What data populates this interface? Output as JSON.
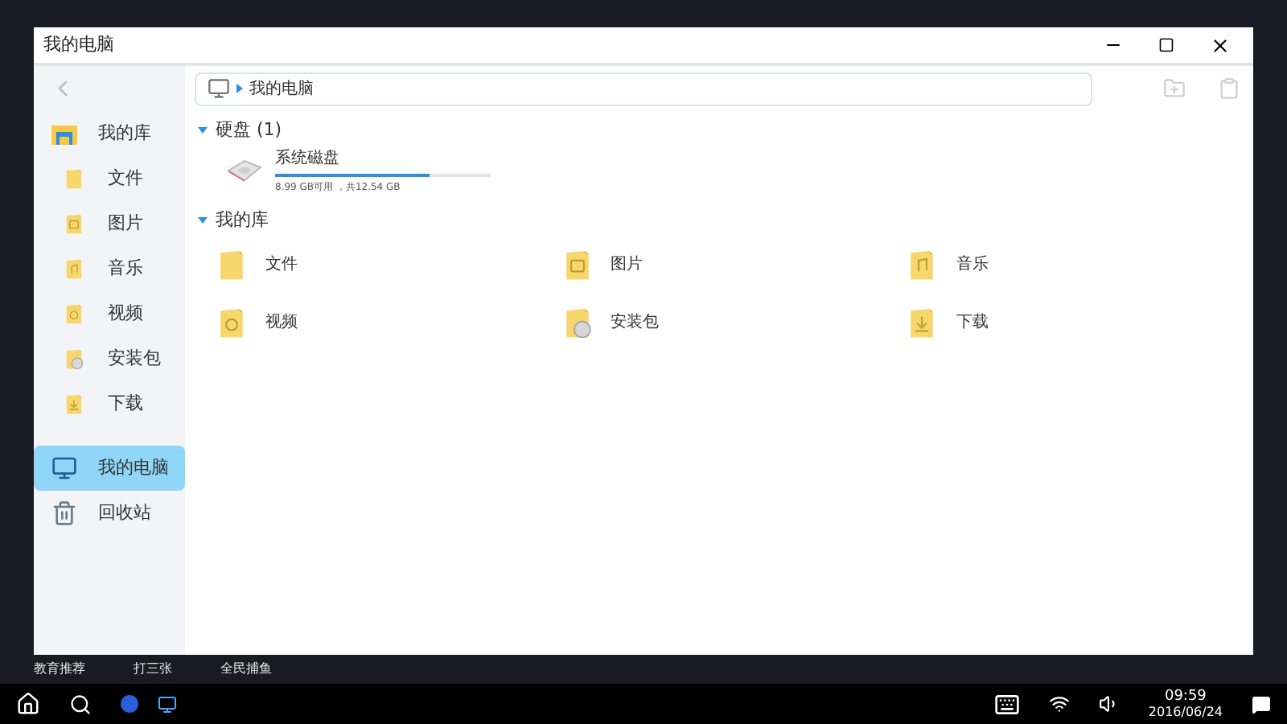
{
  "window": {
    "title": "我的电脑"
  },
  "breadcrumb": {
    "location": "我的电脑"
  },
  "sidebar": {
    "items": [
      {
        "label": "我的库",
        "kind": "library",
        "selected": false,
        "children": [
          {
            "label": "文件",
            "kind": "docs",
            "selected": false
          },
          {
            "label": "图片",
            "kind": "pictures",
            "selected": false
          },
          {
            "label": "音乐",
            "kind": "music",
            "selected": false
          },
          {
            "label": "视频",
            "kind": "video",
            "selected": false
          },
          {
            "label": "安装包",
            "kind": "package",
            "selected": false
          },
          {
            "label": "下载",
            "kind": "download",
            "selected": false
          }
        ]
      },
      {
        "label": "我的电脑",
        "kind": "computer",
        "selected": true
      },
      {
        "label": "回收站",
        "kind": "trash",
        "selected": false
      }
    ]
  },
  "disks_section": {
    "title": "硬盘 (1)",
    "expanded": true,
    "disks": [
      {
        "name": "系统磁盘",
        "level": 0.72,
        "info": "8.99 GB可用 ，共12.54 GB"
      }
    ]
  },
  "library_section": {
    "title": "我的库",
    "expanded": true,
    "items": [
      {
        "label": "文件",
        "kind": "docs"
      },
      {
        "label": "图片",
        "kind": "pictures"
      },
      {
        "label": "音乐",
        "kind": "music"
      },
      {
        "label": "视频",
        "kind": "video"
      },
      {
        "label": "安装包",
        "kind": "package"
      },
      {
        "label": "下载",
        "kind": "download"
      }
    ]
  },
  "desktop_labels": [
    "教育推荐",
    "打三张",
    "全民捕鱼"
  ],
  "taskbar": {
    "time": "09:59",
    "date": "2016/06/24"
  }
}
